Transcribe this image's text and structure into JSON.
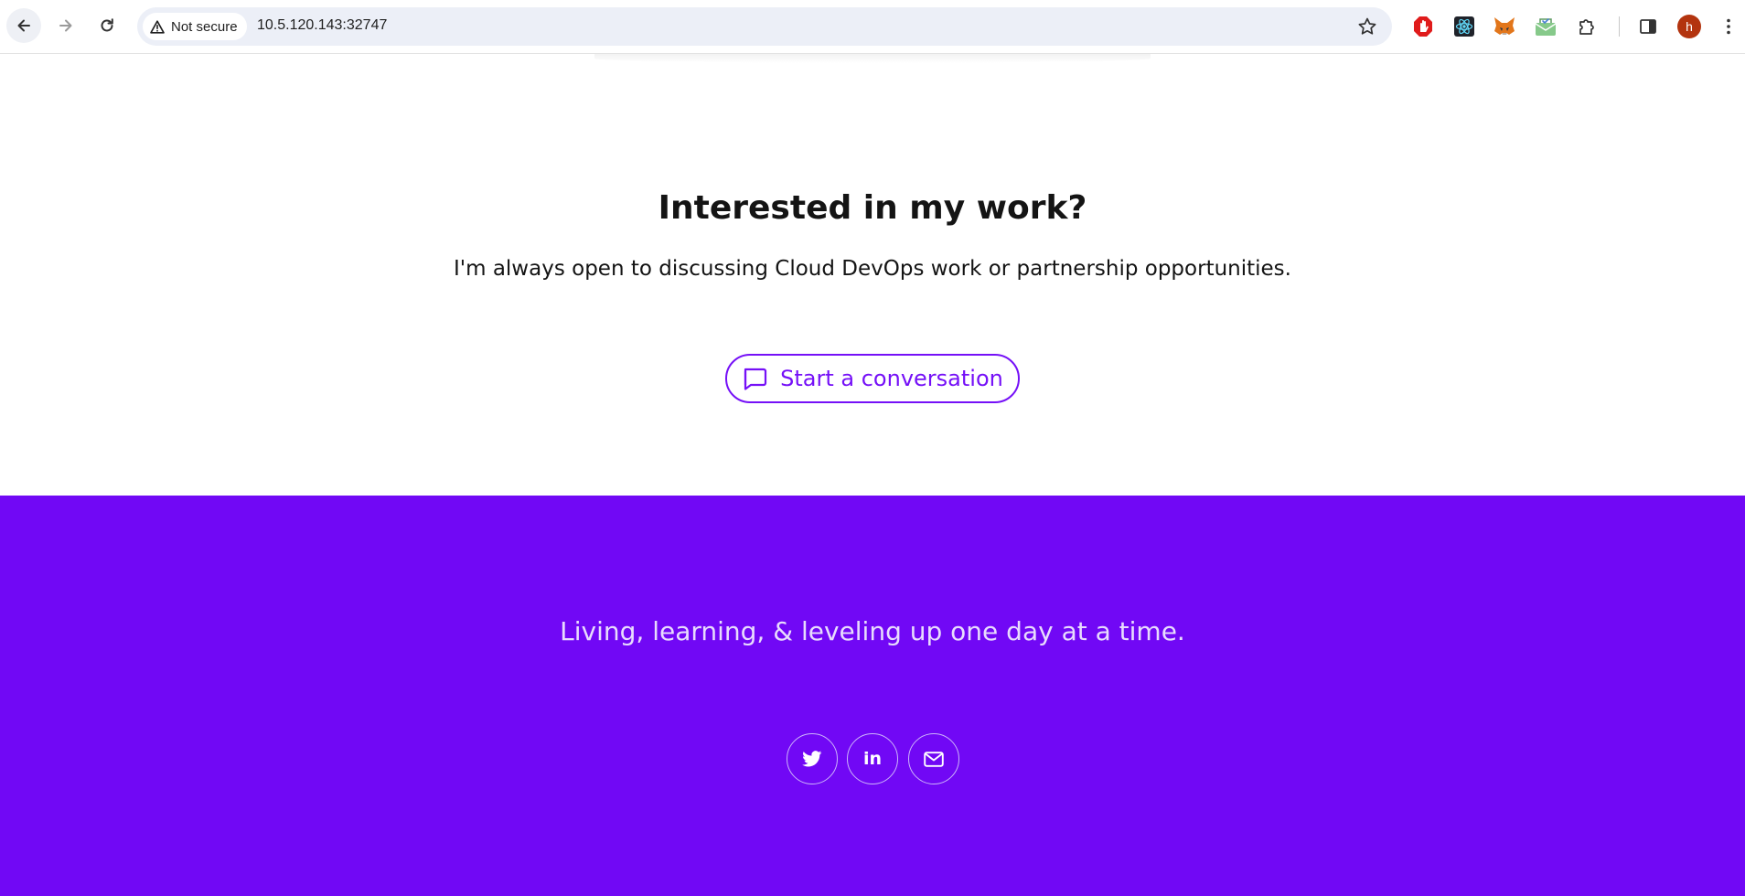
{
  "browser": {
    "security_label": "Not secure",
    "url": "10.5.120.143:32747",
    "profile_initial": "h",
    "icons": {
      "back": "arrow-left-icon",
      "forward": "arrow-right-icon",
      "reload": "reload-icon",
      "security": "warning-triangle-icon",
      "bookmark": "star-icon",
      "extensions": [
        "adblock-icon",
        "react-devtools-icon",
        "metamask-icon",
        "extension-icon",
        "puzzle-icon"
      ],
      "side_panel": "side-panel-icon",
      "menu": "kebab-menu-icon"
    }
  },
  "cta": {
    "title": "Interested in my work?",
    "subtitle": "I'm always open to discussing Cloud DevOps work or partnership opportunities.",
    "button_label": "Start a conversation",
    "button_icon": "chat-bubble-icon"
  },
  "footer": {
    "tagline": "Living, learning, & leveling up one day at a time.",
    "social": [
      {
        "name": "twitter",
        "icon": "twitter-icon"
      },
      {
        "name": "linkedin",
        "icon": "linkedin-icon",
        "glyph": "in"
      },
      {
        "name": "email",
        "icon": "envelope-icon"
      }
    ]
  },
  "colors": {
    "accent": "#7510f7",
    "footer_bg": "#7108f5",
    "footer_text": "#e8dcfd",
    "avatar_bg": "#b3340f"
  }
}
